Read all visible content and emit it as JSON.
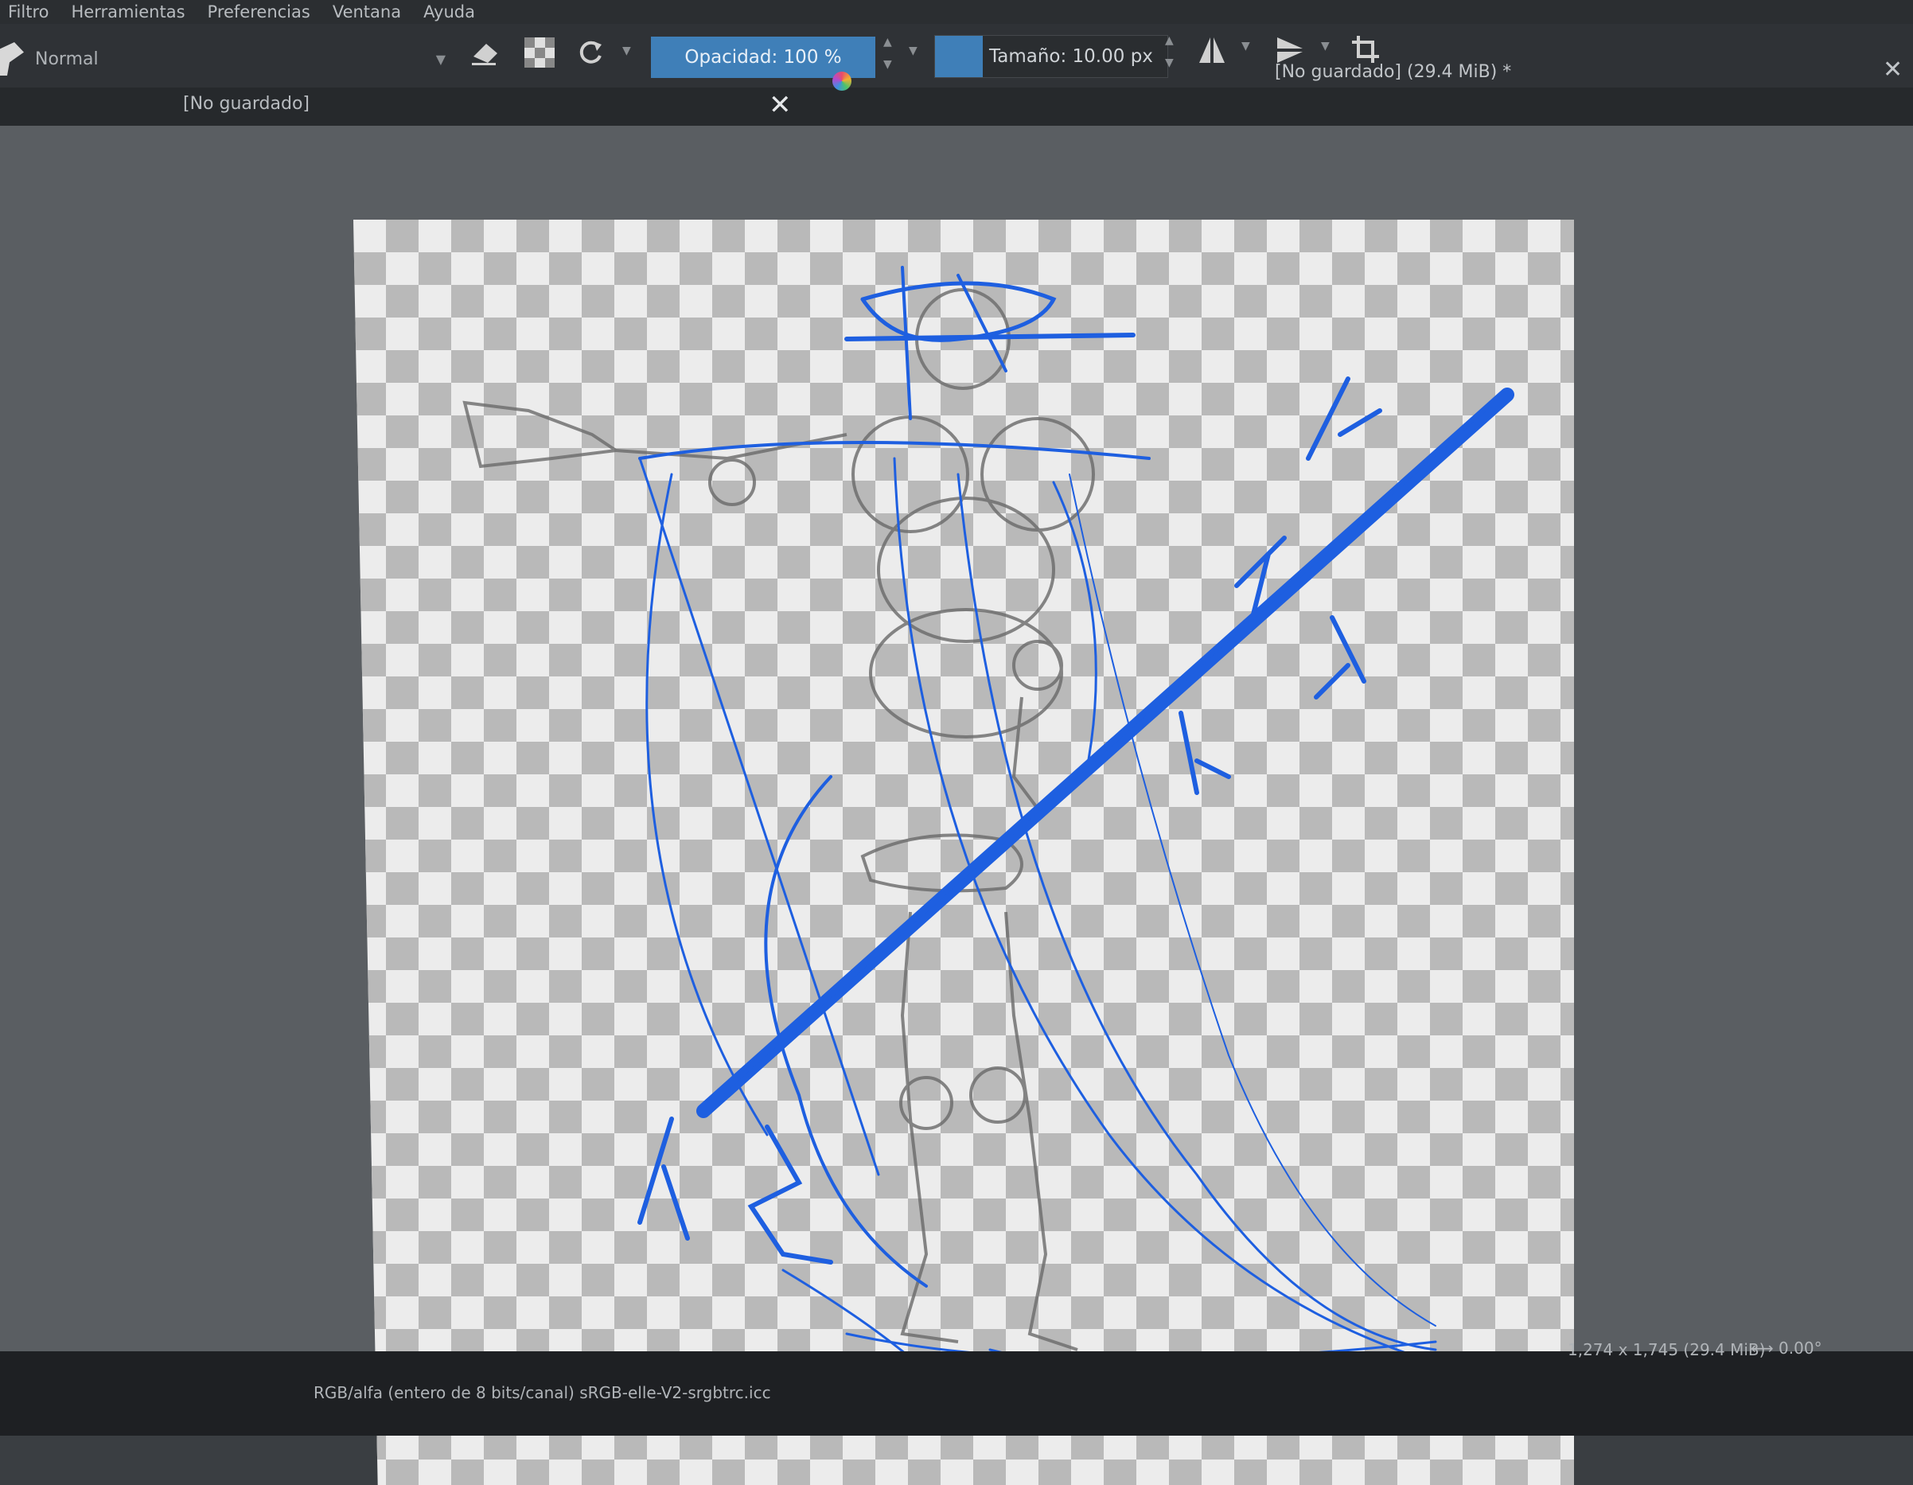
{
  "menu": [
    "Filtro",
    "Herramientas",
    "Preferencias",
    "Ventana",
    "Ayuda"
  ],
  "toolbar": {
    "blend_mode": "Normal",
    "opacity_label": "Opacidad: 100 %",
    "size_label": "Tamaño: 10.00 px"
  },
  "tab": {
    "title": "[No guardado]",
    "document_title": "[No guardado]  (29.4 MiB) *"
  },
  "status": {
    "color_profile": "RGB/alfa (entero de 8 bits/canal)  sRGB-elle-V2-srgbtrc.icc",
    "dimensions": "1,274 x 1,745 (29.4 MiB)",
    "rotation": "0.00°"
  },
  "colors": {
    "sketch_blue": "#1e5fe0",
    "pencil_gray": "#6a6a6a",
    "accent": "#3f7fb8"
  },
  "icons": [
    "brush-icon",
    "eraser-icon",
    "alpha-lock-icon",
    "reload-preset-icon",
    "mirror-horizontal-icon",
    "mirror-vertical-icon",
    "crop-icon",
    "color-selector-icon",
    "close-icon"
  ]
}
